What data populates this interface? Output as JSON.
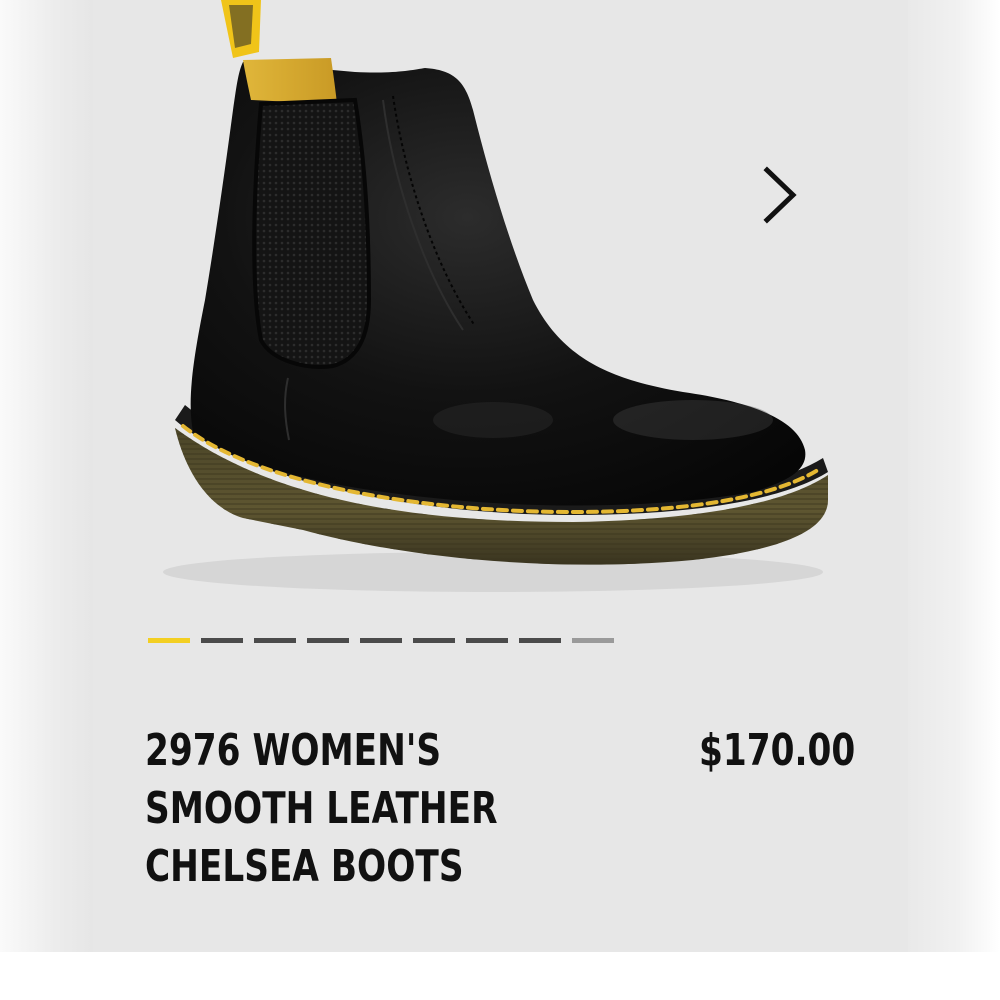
{
  "product": {
    "title_lines": [
      "2976 WOMEN'S",
      "SMOOTH LEATHER",
      "CHELSEA BOOTS"
    ],
    "price": "$170.00",
    "image_subject": "black smooth leather chelsea boot with yellow welt stitching and pull tab"
  },
  "carousel": {
    "total_slides": 9,
    "active_index": 0,
    "next_icon": "chevron-right-icon"
  },
  "colors": {
    "accent": "#f3cf22",
    "text": "#111111",
    "card_background": "#e7e7e7",
    "inactive_indicator": "#4b4b4b"
  }
}
